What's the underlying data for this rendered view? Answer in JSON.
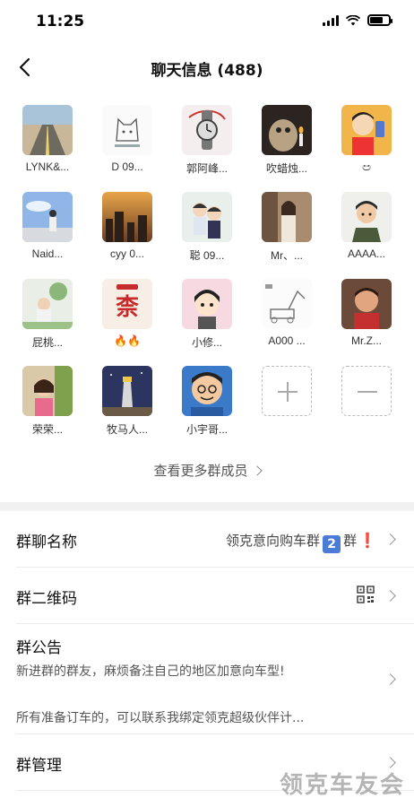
{
  "status": {
    "time": "11:25"
  },
  "header": {
    "title": "聊天信息 (488)"
  },
  "members": [
    {
      "name": "LYNK&...",
      "avatar": "road-icon"
    },
    {
      "name": "D 09...",
      "avatar": "cat-sketch-icon"
    },
    {
      "name": "郭阿峰...",
      "avatar": "watch-icon"
    },
    {
      "name": "吹蜡烛...",
      "avatar": "cat-candle-icon"
    },
    {
      "name": "ඏ",
      "avatar": "cartoon-boy-icon"
    },
    {
      "name": "Naid...",
      "avatar": "sky-person-icon"
    },
    {
      "name": "cyy 0...",
      "avatar": "sunset-city-icon"
    },
    {
      "name": "聪 09...",
      "avatar": "cartoon-couple-icon"
    },
    {
      "name": "Mr、...",
      "avatar": "woman-portrait-icon"
    },
    {
      "name": "AAAA...",
      "avatar": "cartoon-man-icon"
    },
    {
      "name": "屁桃...",
      "avatar": "child-flowers-icon"
    },
    {
      "name": "🔥🔥",
      "avatar": "character-icon"
    },
    {
      "name": "小修...",
      "avatar": "anime-girl-icon"
    },
    {
      "name": "A000 ...",
      "avatar": "excavator-icon"
    },
    {
      "name": "Mr.Z...",
      "avatar": "kid-photo-icon"
    },
    {
      "name": "荣荣...",
      "avatar": "little-girl-icon"
    },
    {
      "name": "牧马人...",
      "avatar": "lighthouse-icon"
    },
    {
      "name": "小宇哥...",
      "avatar": "cartoon-face-icon"
    }
  ],
  "see_more": "查看更多群成员",
  "settings": {
    "group_name_label": "群聊名称",
    "group_name_value_prefix": "领克意向购车群",
    "group_name_value_num": "2",
    "group_name_value_suffix": "群",
    "group_name_value_mark": "❗",
    "qr_label": "群二维码",
    "notice_label": "群公告",
    "notice_line1": "新进群的群友，麻烦备注自己的地区加意向车型!",
    "notice_line2": "所有准备订车的，可以联系我绑定领克超级伙伴计...",
    "manage_label": "群管理"
  },
  "watermark": "领克车友会",
  "colors": {
    "accent_badge": "#4a7bd6",
    "alert": "#d91e1e",
    "divider": "#f1f1f1"
  }
}
